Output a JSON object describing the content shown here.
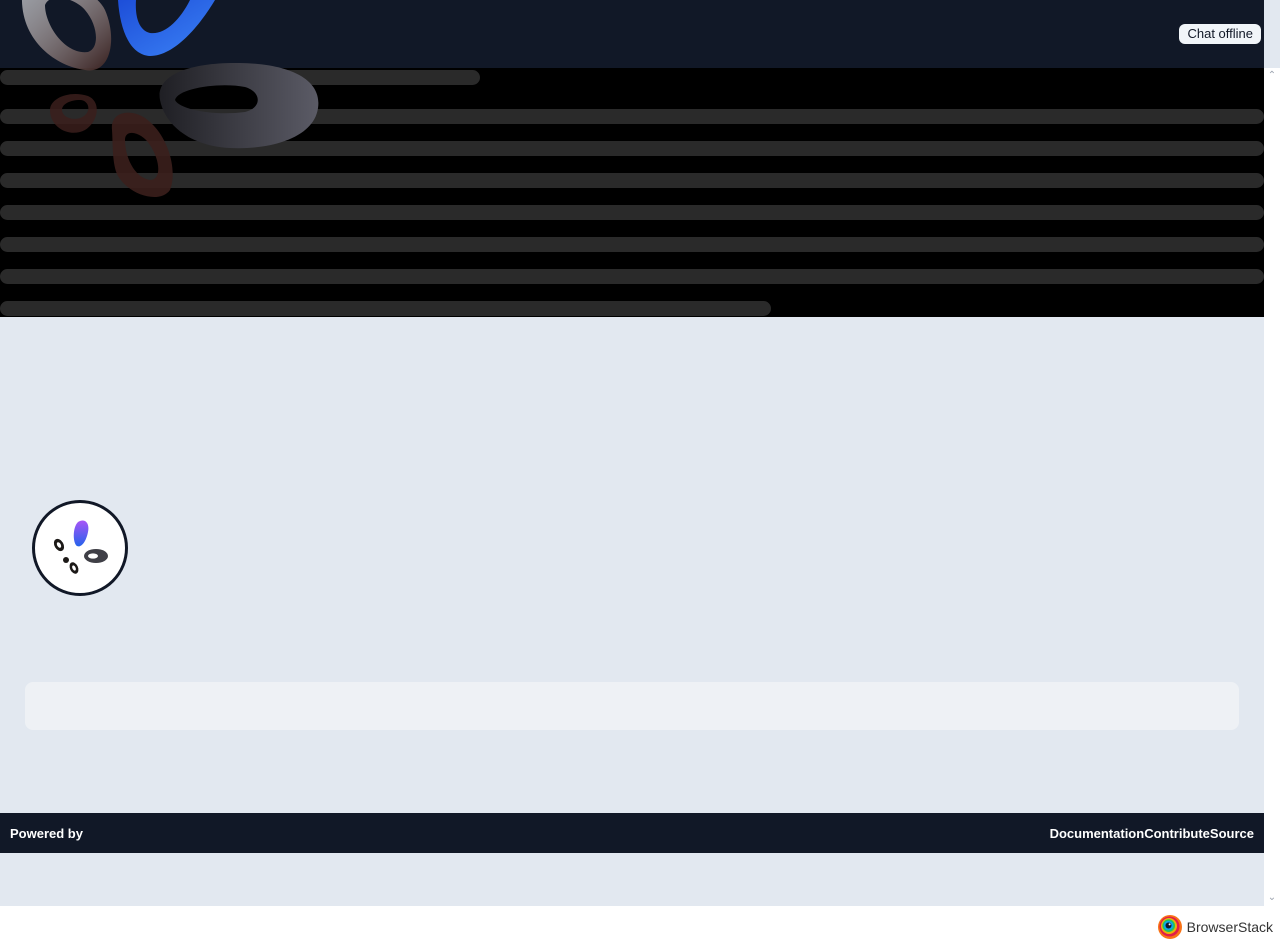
{
  "header": {
    "logo_icon": "abstract-petal-logo-icon",
    "status_label": "Chat offline"
  },
  "loading": {
    "state": "loading-skeleton"
  },
  "chat": {
    "avatar_icon": "petal-logo-icon",
    "input_value": "",
    "input_placeholder": ""
  },
  "footer": {
    "powered_by": "Powered by",
    "links": [
      "Documentation",
      "Contribute",
      "Source"
    ]
  },
  "scrollbar": {
    "up_icon": "chevron-up-icon",
    "down_icon": "chevron-down-icon",
    "up_glyph": "⌃",
    "down_glyph": "⌄"
  },
  "bottom_bar": {
    "brand_icon": "browserstack-icon",
    "brand_name": "BrowserStack"
  },
  "colors": {
    "header_bg": "#111827",
    "skeleton_bg": "#000000",
    "skeleton_bar": "#2a2a2a",
    "page_bg": "#e2e8f0",
    "input_bg": "#eef1f5",
    "footer_bg": "#111827",
    "logo_blue": "#2563eb",
    "logo_purple": "#a855f7",
    "logo_brown": "#3b1f1c"
  }
}
